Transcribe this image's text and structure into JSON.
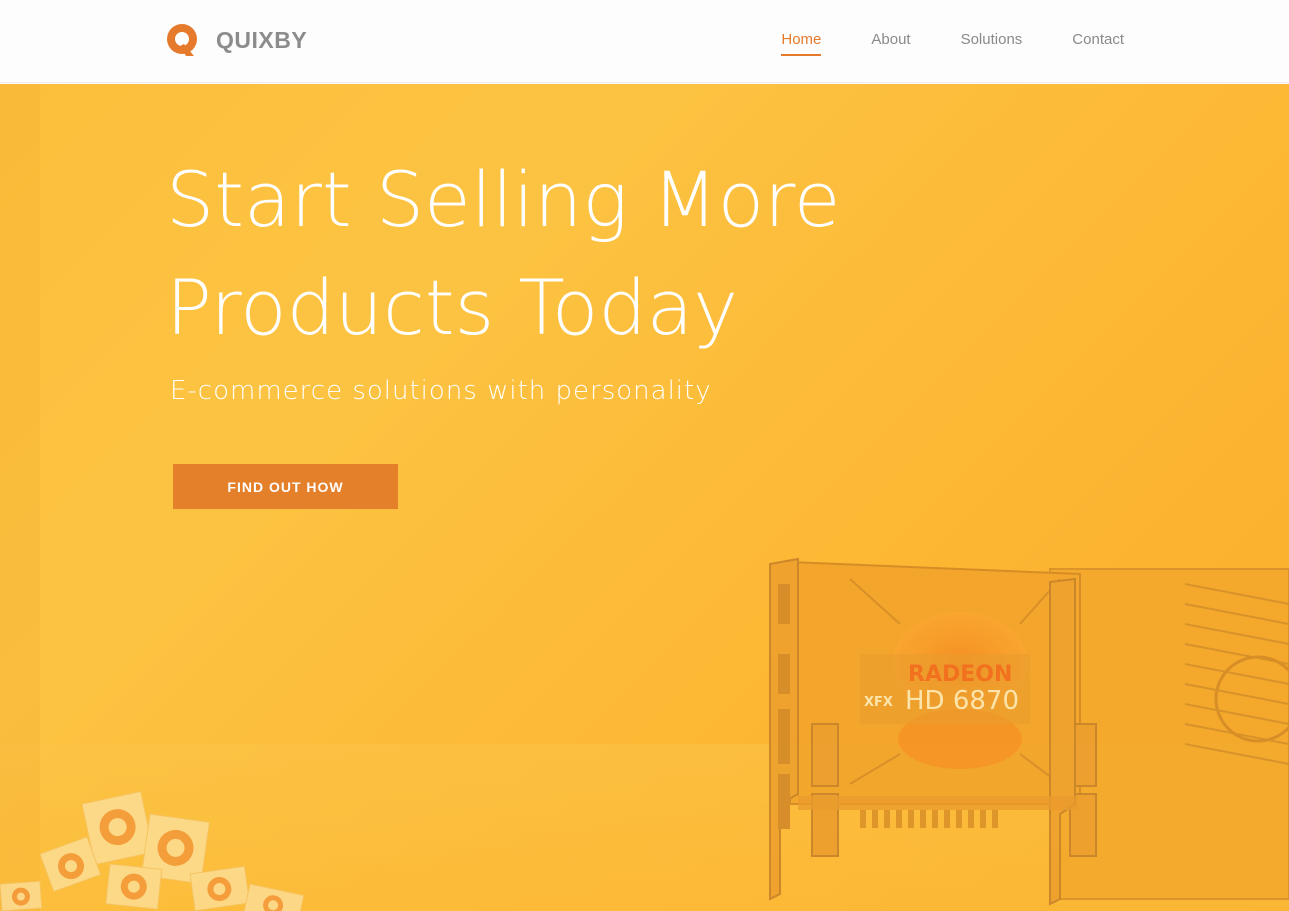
{
  "brand": {
    "name": "QUIXBY",
    "logo_icon": "quixby-q-logo-icon",
    "accent_color": "#e67a2c"
  },
  "nav": {
    "items": [
      {
        "label": "Home",
        "active": true
      },
      {
        "label": "About",
        "active": false
      },
      {
        "label": "Solutions",
        "active": false
      },
      {
        "label": "Contact",
        "active": false
      }
    ]
  },
  "hero": {
    "headline_line1": "Start Selling More",
    "headline_line2": "Products Today",
    "subtitle": "E-commerce solutions with personality",
    "cta_label": "FIND OUT HOW",
    "background_color": "#fcbf3c",
    "product_card_brand": "XFX",
    "product_card_model": "RADEON",
    "product_card_series": "HD 6870"
  }
}
